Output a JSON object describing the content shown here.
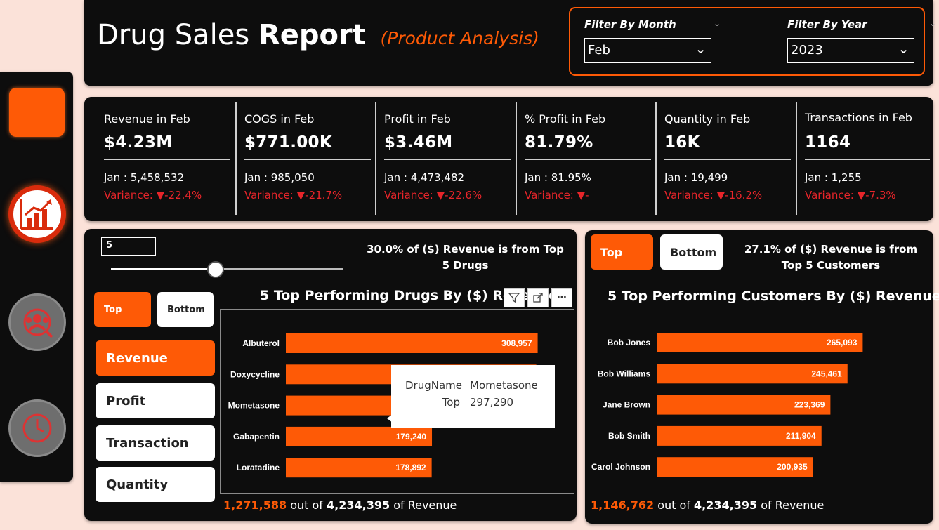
{
  "header": {
    "title_light": "Drug Sales",
    "title_bold": "Report",
    "subtitle": "(Product Analysis)",
    "filters": [
      {
        "label": "Filter By Month",
        "value": "Feb"
      },
      {
        "label": "Filter By Year",
        "value": "2023"
      }
    ]
  },
  "nav": {
    "items": [
      "home-icon",
      "report-chart-icon",
      "customer-analysis-icon",
      "time-analysis-icon"
    ]
  },
  "kpis": [
    {
      "title": "Revenue in Feb",
      "value": "$4.23M",
      "prev": "Jan : 5,458,532",
      "variance": "Variance: ▼-22.4%"
    },
    {
      "title": "COGS in Feb",
      "value": "$771.00K",
      "prev": "Jan : 985,050",
      "variance": "Variance: ▼-21.7%"
    },
    {
      "title": "Profit in Feb",
      "value": "$3.46M",
      "prev": "Jan : 4,473,482",
      "variance": "Variance: ▼-22.6%"
    },
    {
      "title": "% Profit in Feb",
      "value": "81.79%",
      "prev": "Jan : 81.95%",
      "variance": "Variance: ▼-"
    },
    {
      "title": "Quantity in Feb",
      "value": "16K",
      "prev": "Jan : 19,499",
      "variance": "Variance: ▼-16.2%"
    },
    {
      "title": "Transactions in Feb",
      "value": "1164",
      "prev": "Jan : 1,255",
      "variance": "Variance: ▼-7.3%"
    }
  ],
  "drug_panel": {
    "top_n": "5",
    "slider_fraction": 0.45,
    "note": "30.0% of ($) Revenue is from Top 5 Drugs",
    "toggle": {
      "top": "Top",
      "bottom": "Bottom"
    },
    "metrics": [
      "Revenue",
      "Profit",
      "Transaction",
      "Quantity"
    ],
    "chart_title": "5 Top Performing Drugs By ($) Revenue",
    "tools": [
      "filter-icon",
      "focus-mode-icon",
      "more-options-icon"
    ],
    "tooltip": {
      "k1": "DrugName",
      "v1": "Mometasone",
      "k2": "Top",
      "v2": "297,290"
    },
    "footer": {
      "part": "1,271,588",
      "mid": "out of",
      "total": "4,234,395",
      "of": "of",
      "measure": "Revenue"
    }
  },
  "customer_panel": {
    "toggle": {
      "top": "Top",
      "bottom": "Bottom"
    },
    "note": "27.1% of ($) Revenue is from Top 5 Customers",
    "chart_title": "5 Top Performing Customers By ($) Revenue",
    "footer": {
      "part": "1,146,762",
      "mid": "out of",
      "total": "4,234,395",
      "of": "of",
      "measure": "Revenue"
    }
  },
  "colors": {
    "accent": "#fe5a06",
    "negative": "#e8252a",
    "panel": "#0d0d0d",
    "background": "#fbe2d9"
  },
  "chart_data": [
    {
      "type": "bar",
      "orientation": "horizontal",
      "title": "5 Top Performing Drugs By ($) Revenue",
      "categories": [
        "Albuterol",
        "Doxycycline",
        "Mometasone",
        "Gabapentin",
        "Loratadine"
      ],
      "values": [
        308957,
        307260,
        297290,
        179240,
        178892
      ],
      "value_labels": [
        "308,957",
        "",
        "",
        "179,240",
        "178,892"
      ],
      "xlim": [
        0,
        330000
      ]
    },
    {
      "type": "bar",
      "orientation": "horizontal",
      "title": "5 Top Performing Customers By ($) Revenue",
      "categories": [
        "Bob Jones",
        "Bob Williams",
        "Jane Brown",
        "Bob Smith",
        "Carol Johnson"
      ],
      "values": [
        265093,
        245461,
        223369,
        211904,
        200935
      ],
      "value_labels": [
        "265,093",
        "245,461",
        "223,369",
        "211,904",
        "200,935"
      ],
      "xlim": [
        0,
        330000
      ]
    }
  ]
}
